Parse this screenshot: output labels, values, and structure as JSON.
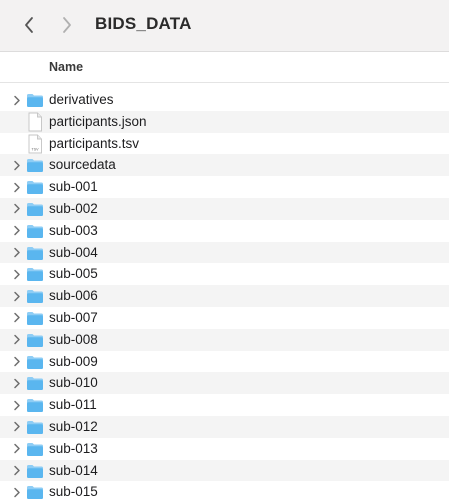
{
  "window": {
    "title": "BIDS_DATA"
  },
  "header": {
    "name_label": "Name"
  },
  "colors": {
    "folder_top": "#8ecdf5",
    "folder_body": "#5ab6ef",
    "alt_row": "#f4f4f4"
  },
  "items": [
    {
      "name": "derivatives",
      "kind": "folder"
    },
    {
      "name": "participants.json",
      "kind": "file"
    },
    {
      "name": "participants.tsv",
      "kind": "tsv"
    },
    {
      "name": "sourcedata",
      "kind": "folder"
    },
    {
      "name": "sub-001",
      "kind": "folder"
    },
    {
      "name": "sub-002",
      "kind": "folder"
    },
    {
      "name": "sub-003",
      "kind": "folder"
    },
    {
      "name": "sub-004",
      "kind": "folder"
    },
    {
      "name": "sub-005",
      "kind": "folder"
    },
    {
      "name": "sub-006",
      "kind": "folder"
    },
    {
      "name": "sub-007",
      "kind": "folder"
    },
    {
      "name": "sub-008",
      "kind": "folder"
    },
    {
      "name": "sub-009",
      "kind": "folder"
    },
    {
      "name": "sub-010",
      "kind": "folder"
    },
    {
      "name": "sub-011",
      "kind": "folder"
    },
    {
      "name": "sub-012",
      "kind": "folder"
    },
    {
      "name": "sub-013",
      "kind": "folder"
    },
    {
      "name": "sub-014",
      "kind": "folder"
    },
    {
      "name": "sub-015",
      "kind": "folder"
    }
  ],
  "file_badges": {
    "tsv": "TSV"
  }
}
